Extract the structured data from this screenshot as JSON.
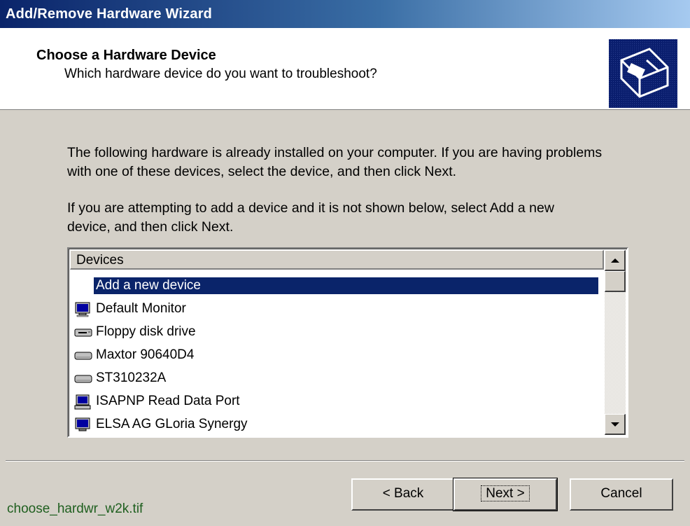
{
  "window": {
    "title": "Add/Remove Hardware Wizard"
  },
  "header": {
    "title": "Choose a Hardware Device",
    "subtitle": "Which hardware device do you want to troubleshoot?",
    "icon": "hardware-wizard-icon"
  },
  "body": {
    "para1_line1": "The following hardware is already installed on your computer. If you are having problems",
    "para1_line2": "with one of these devices, select the device, and then click Next.",
    "para2_line1": "If you are attempting to add a device and it is not shown below, select Add a new",
    "para2_line2": "device, and then click Next."
  },
  "devices": {
    "column_header": "Devices",
    "items": [
      {
        "label": "Add a new device",
        "icon": "none",
        "selected": true
      },
      {
        "label": "Default Monitor",
        "icon": "monitor-icon"
      },
      {
        "label": "Floppy disk drive",
        "icon": "floppy-drive-icon"
      },
      {
        "label": "Maxtor 90640D4",
        "icon": "hard-disk-icon"
      },
      {
        "label": "ST310232A",
        "icon": "hard-disk-icon"
      },
      {
        "label": "ISAPNP Read Data Port",
        "icon": "computer-icon"
      },
      {
        "label": "ELSA AG GLoria Synergy",
        "icon": "monitor-icon"
      }
    ]
  },
  "buttons": {
    "back": "< Back",
    "next": "Next >",
    "cancel": "Cancel"
  },
  "caption": "choose_hardwr_w2k.tif",
  "colors": {
    "selection": "#0a246a",
    "face": "#d4d0c8",
    "caption": "#1f5f1f"
  }
}
